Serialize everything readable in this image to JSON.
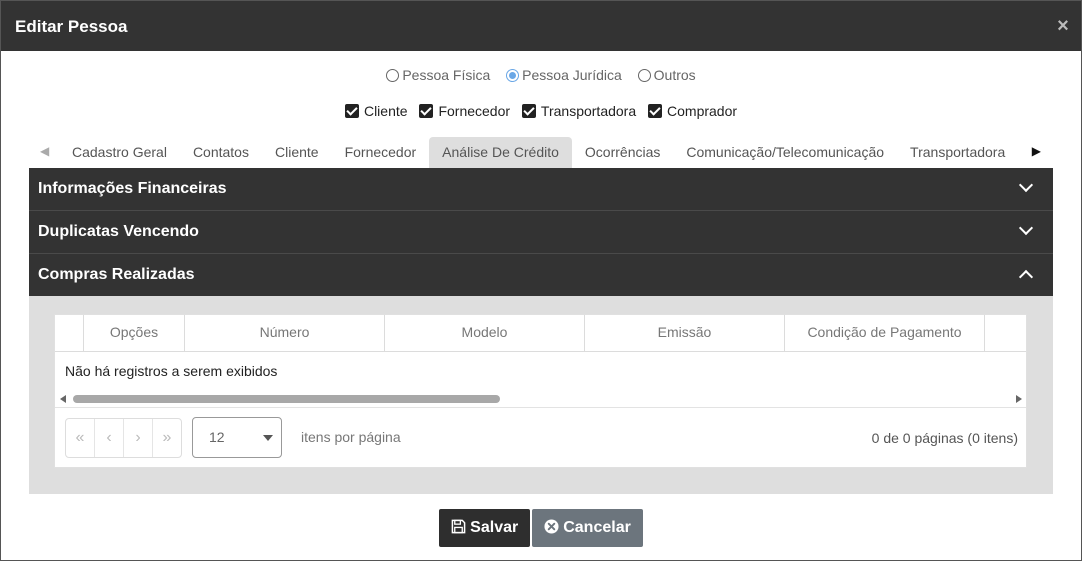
{
  "dialog": {
    "title": "Editar Pessoa",
    "close_glyph": "×"
  },
  "person_type": {
    "options": [
      {
        "label": "Pessoa Física",
        "checked": false
      },
      {
        "label": "Pessoa Jurídica",
        "checked": true
      },
      {
        "label": "Outros",
        "checked": false
      }
    ]
  },
  "roles": {
    "options": [
      {
        "label": "Cliente",
        "checked": true
      },
      {
        "label": "Fornecedor",
        "checked": true
      },
      {
        "label": "Transportadora",
        "checked": true
      },
      {
        "label": "Comprador",
        "checked": true
      }
    ]
  },
  "tabs": {
    "items": [
      "Cadastro Geral",
      "Contatos",
      "Cliente",
      "Fornecedor",
      "Análise De Crédito",
      "Ocorrências",
      "Comunicação/Telecomunicação",
      "Transportadora"
    ],
    "active_index": 4
  },
  "accordion": {
    "panels": [
      {
        "label": "Informações Financeiras",
        "expanded": false
      },
      {
        "label": "Duplicatas Vencendo",
        "expanded": false
      },
      {
        "label": "Compras Realizadas",
        "expanded": true
      }
    ]
  },
  "grid": {
    "columns": [
      "",
      "Opções",
      "Número",
      "Modelo",
      "Emissão",
      "Condição de Pagamento"
    ],
    "empty_message": "Não há registros a serem exibidos"
  },
  "pager": {
    "buttons": [
      "«",
      "‹",
      "›",
      "»"
    ],
    "page_size": "12",
    "page_size_label": "itens por página",
    "info": "0 de 0 páginas (0 itens)"
  },
  "footer": {
    "save_label": "Salvar",
    "cancel_label": "Cancelar"
  },
  "colors": {
    "header_bg": "#333333",
    "radio_accent": "#6aa7e6",
    "cancel_bg": "#6c757d",
    "panel_body_bg": "#dedede"
  }
}
